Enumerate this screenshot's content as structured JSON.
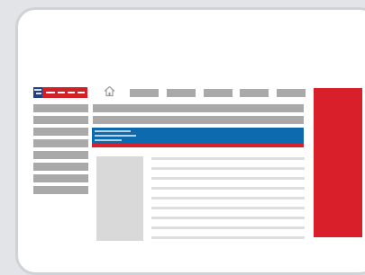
{
  "header": {
    "logo": {
      "name": "flag-logo",
      "colors": {
        "red": "#d32027",
        "blue": "#1f3f86",
        "white": "#ffffff"
      }
    },
    "home_icon": "home-icon",
    "nav_items": [
      "",
      "",
      "",
      "",
      ""
    ]
  },
  "sidebar": {
    "items": [
      "",
      "",
      "",
      "",
      "",
      "",
      "",
      ""
    ]
  },
  "main": {
    "top_bars": [
      "",
      ""
    ],
    "banner": {
      "colors": {
        "background": "#0e6aae",
        "accent": "#d9202a"
      }
    },
    "image_placeholder": "image-placeholder",
    "text_lines": [
      "",
      "",
      "",
      "",
      "",
      "",
      "",
      "",
      "",
      "",
      ""
    ]
  },
  "right_panel": {
    "color": "#d9202a"
  },
  "colors": {
    "page_background": "#e2e4e7",
    "frame_border": "#cfd2d6",
    "placeholder_grey": "#a9a9a9",
    "light_grey": "#dedede"
  }
}
